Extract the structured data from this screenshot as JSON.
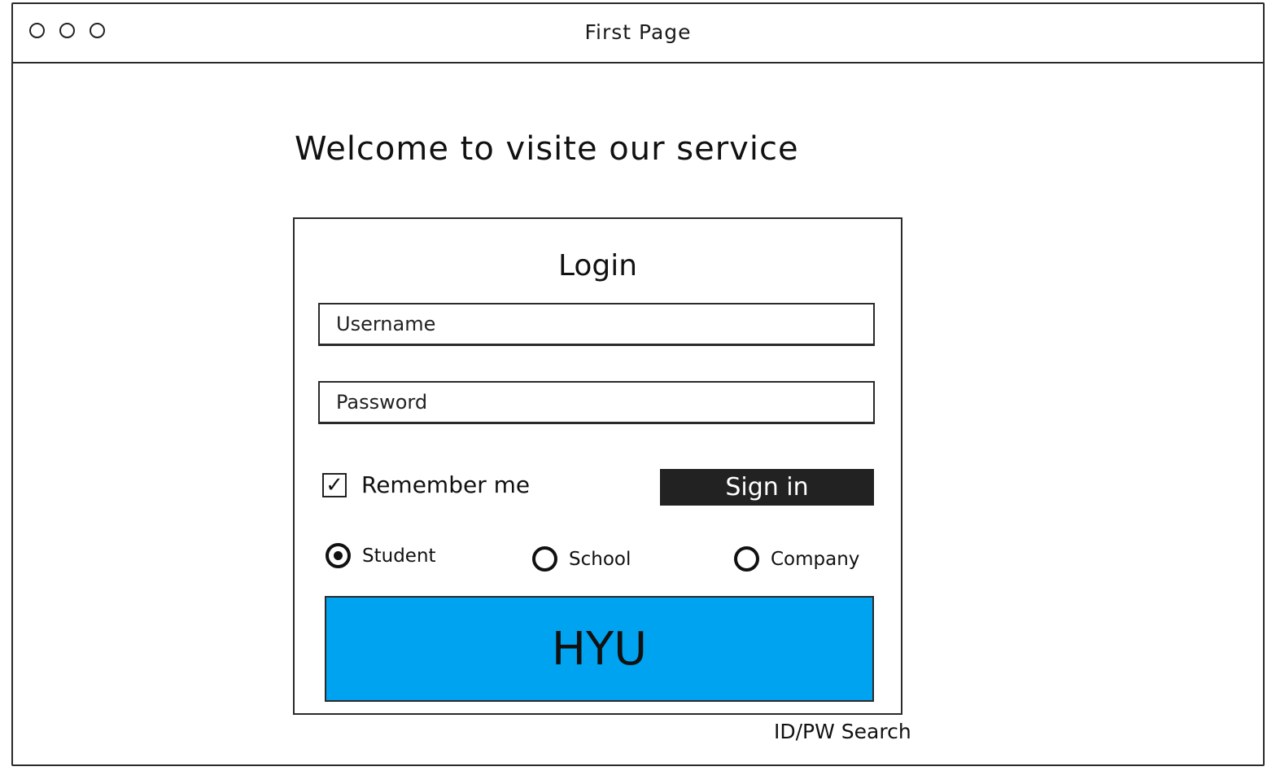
{
  "window": {
    "title": "First Page"
  },
  "page": {
    "welcome": "Welcome to visite our service"
  },
  "login": {
    "title": "Login",
    "username_placeholder": "Username",
    "password_placeholder": "Password",
    "remember_label": "Remember me",
    "remember_checked": true,
    "checkbox_glyph": "✓",
    "signin_label": "Sign in",
    "roles": [
      {
        "label": "Student",
        "selected": true
      },
      {
        "label": "School",
        "selected": false
      },
      {
        "label": "Company",
        "selected": false
      }
    ],
    "brand_button_label": "HYU",
    "brand_color": "#00a3ef",
    "id_pw_search_label": "ID/PW Search"
  }
}
